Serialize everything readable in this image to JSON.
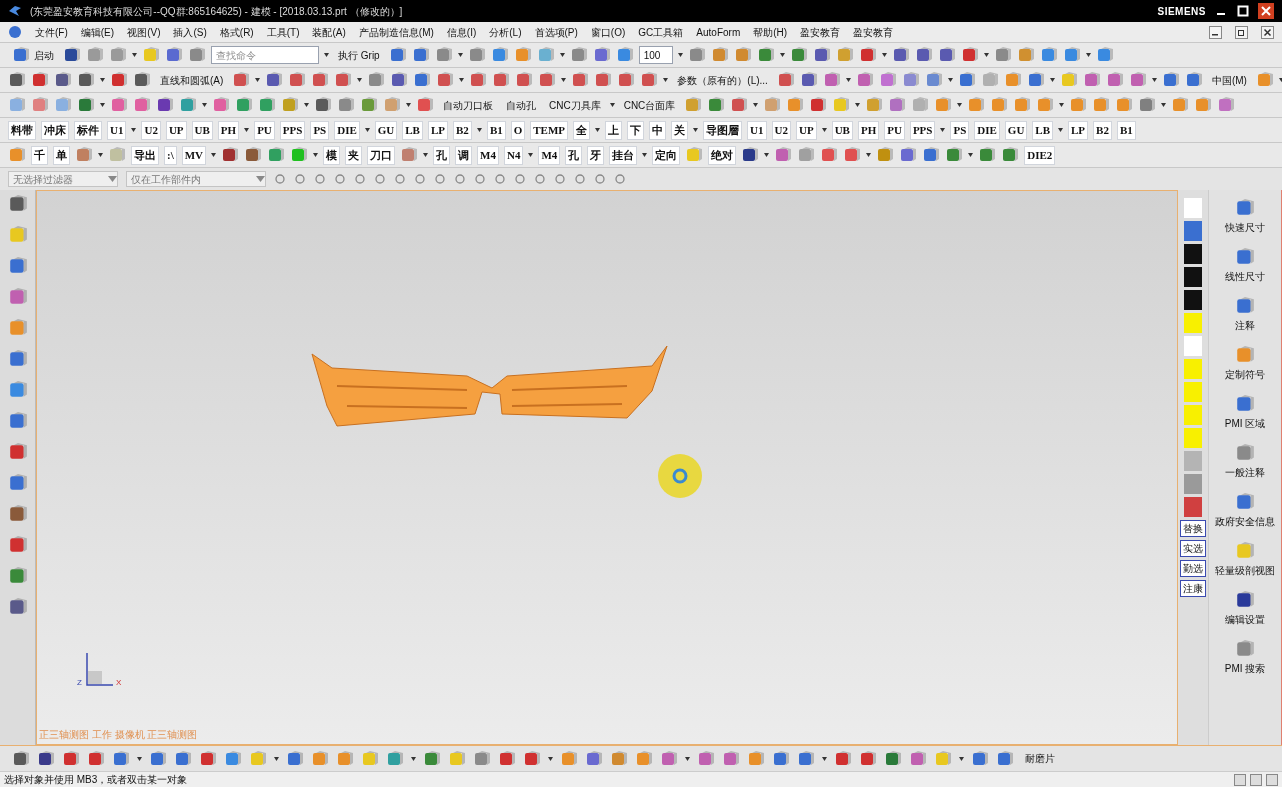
{
  "window": {
    "title": "(东莞盈安教育科技有限公司--QQ群:865164625) - 建模 - [2018.03.13.prt （修改的）]",
    "brand": "SIEMENS"
  },
  "menu": {
    "items": [
      {
        "label": "文件(F)"
      },
      {
        "label": "编辑(E)"
      },
      {
        "label": "视图(V)"
      },
      {
        "label": "插入(S)"
      },
      {
        "label": "格式(R)"
      },
      {
        "label": "工具(T)"
      },
      {
        "label": "装配(A)"
      },
      {
        "label": "产品制造信息(M)"
      },
      {
        "label": "信息(I)"
      },
      {
        "label": "分析(L)"
      },
      {
        "label": "首选项(P)"
      },
      {
        "label": "窗口(O)"
      },
      {
        "label": "GC工具箱"
      },
      {
        "label": "AutoForm"
      },
      {
        "label": "帮助(H)"
      },
      {
        "label": "盈安教育"
      },
      {
        "label": "盈安教育"
      }
    ]
  },
  "toolbars": [
    {
      "items": [
        {
          "kind": "labeled",
          "label": "启动",
          "color": "#3a6fd0"
        },
        {
          "kind": "icon",
          "color": "#2a4a9a"
        },
        {
          "kind": "icon",
          "color": "#9a9a9a"
        },
        {
          "kind": "icon",
          "color": "#9a9a9a"
        },
        {
          "kind": "icon",
          "color": "#e8c820"
        },
        {
          "kind": "icon",
          "color": "#5a6ad0"
        },
        {
          "kind": "icon",
          "color": "#8a8a8a"
        },
        {
          "kind": "search",
          "placeholder": "查找命令"
        },
        {
          "kind": "text",
          "label": "执行 Grip"
        },
        {
          "kind": "icon",
          "color": "#3a6fd0"
        },
        {
          "kind": "icon",
          "color": "#3a6fd0"
        },
        {
          "kind": "icon",
          "color": "#8a8a8a"
        },
        {
          "kind": "icon",
          "color": "#8a8a8a"
        },
        {
          "kind": "icon",
          "color": "#3a8ae0"
        },
        {
          "kind": "icon",
          "color": "#e8902a"
        },
        {
          "kind": "icon",
          "color": "#6ab0d0"
        },
        {
          "kind": "icon",
          "color": "#8a8a8a"
        },
        {
          "kind": "icon",
          "color": "#6a6ad0"
        },
        {
          "kind": "icon",
          "color": "#3a8ae0"
        },
        {
          "kind": "zoom",
          "value": "100"
        },
        {
          "kind": "icon",
          "color": "#8a8a8a"
        },
        {
          "kind": "icon",
          "color": "#d08a30"
        },
        {
          "kind": "icon",
          "color": "#d08a30"
        },
        {
          "kind": "icon",
          "color": "#3a8a3a"
        },
        {
          "kind": "icon",
          "color": "#3a8a3a"
        },
        {
          "kind": "icon",
          "color": "#5a5ab0"
        },
        {
          "kind": "icon",
          "color": "#d0a030"
        },
        {
          "kind": "icon",
          "color": "#d03030"
        },
        {
          "kind": "icon",
          "color": "#5a5ab0"
        },
        {
          "kind": "icon",
          "color": "#5a5ab0"
        },
        {
          "kind": "icon",
          "color": "#5a5ab0"
        },
        {
          "kind": "icon",
          "color": "#d03030"
        },
        {
          "kind": "icon",
          "color": "#8a8a8a"
        },
        {
          "kind": "icon",
          "color": "#d09030"
        },
        {
          "kind": "icon",
          "color": "#3a8ae0"
        },
        {
          "kind": "icon",
          "color": "#3a8ae0"
        },
        {
          "kind": "icon",
          "color": "#3a8ae0"
        }
      ]
    },
    {
      "items": [
        {
          "kind": "icon",
          "color": "#5a5a5a"
        },
        {
          "kind": "icon",
          "color": "#d03030"
        },
        {
          "kind": "icon",
          "color": "#5a5a8a"
        },
        {
          "kind": "icon",
          "color": "#5a5a5a"
        },
        {
          "kind": "icon",
          "color": "#d03030"
        },
        {
          "kind": "icon",
          "color": "#5a5a5a"
        },
        {
          "kind": "text",
          "label": "直线和圆弧(A)"
        },
        {
          "kind": "icon",
          "color": "#d05050"
        },
        {
          "kind": "icon",
          "color": "#5a5ab0"
        },
        {
          "kind": "icon",
          "color": "#d05050"
        },
        {
          "kind": "icon",
          "color": "#d05050"
        },
        {
          "kind": "icon",
          "color": "#d05050"
        },
        {
          "kind": "icon",
          "color": "#8a8a8a"
        },
        {
          "kind": "icon",
          "color": "#5a5ab0"
        },
        {
          "kind": "icon",
          "color": "#3a6fd0"
        },
        {
          "kind": "icon",
          "color": "#d05050"
        },
        {
          "kind": "icon",
          "color": "#d05050"
        },
        {
          "kind": "icon",
          "color": "#d05050"
        },
        {
          "kind": "icon",
          "color": "#d05050"
        },
        {
          "kind": "icon",
          "color": "#d05050"
        },
        {
          "kind": "icon",
          "color": "#d05050"
        },
        {
          "kind": "icon",
          "color": "#d05050"
        },
        {
          "kind": "icon",
          "color": "#d05050"
        },
        {
          "kind": "icon",
          "color": "#d05050"
        },
        {
          "kind": "text",
          "label": "参数（原有的）(L)..."
        },
        {
          "kind": "icon",
          "color": "#d05050"
        },
        {
          "kind": "icon",
          "color": "#5a5ab0"
        },
        {
          "kind": "icon",
          "color": "#c060b0"
        },
        {
          "kind": "icon",
          "color": "#c060b0"
        },
        {
          "kind": "icon",
          "color": "#c070d0"
        },
        {
          "kind": "icon",
          "color": "#8a8ad0"
        },
        {
          "kind": "icon",
          "color": "#6a8ad0"
        },
        {
          "kind": "icon",
          "color": "#3a6fd0"
        },
        {
          "kind": "icon",
          "color": "#b0b0b0"
        },
        {
          "kind": "icon",
          "color": "#e8902a"
        },
        {
          "kind": "icon",
          "color": "#3a6fd0"
        },
        {
          "kind": "icon",
          "color": "#e8c820"
        },
        {
          "kind": "icon",
          "color": "#c060b0"
        },
        {
          "kind": "icon",
          "color": "#c060b0"
        },
        {
          "kind": "icon",
          "color": "#c060b0"
        },
        {
          "kind": "icon",
          "color": "#3a6fd0"
        },
        {
          "kind": "icon",
          "color": "#3a6fd0"
        },
        {
          "kind": "text",
          "label": "中国(M)"
        },
        {
          "kind": "icon",
          "color": "#e8902a"
        }
      ]
    },
    {
      "items": [
        {
          "kind": "icon",
          "color": "#8ab0e0"
        },
        {
          "kind": "icon",
          "color": "#e08080"
        },
        {
          "kind": "icon",
          "color": "#8ab0e0"
        },
        {
          "kind": "icon",
          "color": "#2a7a3a"
        },
        {
          "kind": "icon",
          "color": "#e060a0"
        },
        {
          "kind": "icon",
          "color": "#e060a0"
        },
        {
          "kind": "icon",
          "color": "#6a3ab0"
        },
        {
          "kind": "icon",
          "color": "#30a0a0"
        },
        {
          "kind": "icon",
          "color": "#e060a0"
        },
        {
          "kind": "icon",
          "color": "#30a060"
        },
        {
          "kind": "icon",
          "color": "#30a060"
        },
        {
          "kind": "icon",
          "color": "#c0a020"
        },
        {
          "kind": "icon",
          "color": "#5a5a5a"
        },
        {
          "kind": "icon",
          "color": "#8a8a8a"
        },
        {
          "kind": "icon",
          "color": "#6a9a3a"
        },
        {
          "kind": "icon",
          "color": "#d0a070"
        },
        {
          "kind": "icon",
          "color": "#e05050"
        },
        {
          "kind": "text",
          "label": "自动刀口板"
        },
        {
          "kind": "text",
          "label": "自动孔"
        },
        {
          "kind": "text",
          "label": "CNC刀具库"
        },
        {
          "kind": "text",
          "label": "CNC台面库"
        },
        {
          "kind": "icon",
          "color": "#d0a030"
        },
        {
          "kind": "icon",
          "color": "#3a8a3a"
        },
        {
          "kind": "icon",
          "color": "#d05050"
        },
        {
          "kind": "icon",
          "color": "#d0a070"
        },
        {
          "kind": "icon",
          "color": "#e8902a"
        },
        {
          "kind": "icon",
          "color": "#d03030"
        },
        {
          "kind": "icon",
          "color": "#e8c820"
        },
        {
          "kind": "icon",
          "color": "#d0a030"
        },
        {
          "kind": "icon",
          "color": "#b070c0"
        },
        {
          "kind": "icon",
          "color": "#b0b0b0"
        },
        {
          "kind": "icon",
          "color": "#e8902a"
        },
        {
          "kind": "icon",
          "color": "#e8902a"
        },
        {
          "kind": "icon",
          "color": "#e8902a"
        },
        {
          "kind": "icon",
          "color": "#e8902a"
        },
        {
          "kind": "icon",
          "color": "#e8902a"
        },
        {
          "kind": "icon",
          "color": "#e8902a"
        },
        {
          "kind": "icon",
          "color": "#e8902a"
        },
        {
          "kind": "icon",
          "color": "#e8902a"
        },
        {
          "kind": "icon",
          "color": "#808080"
        },
        {
          "kind": "icon",
          "color": "#e8902a"
        },
        {
          "kind": "icon",
          "color": "#e8902a"
        },
        {
          "kind": "icon",
          "color": "#c070c0"
        }
      ]
    },
    {
      "items": [
        {
          "kind": "tile",
          "label": "料带"
        },
        {
          "kind": "tile",
          "label": "冲床"
        },
        {
          "kind": "tile",
          "label": "标件"
        },
        {
          "kind": "tile",
          "label": "U1"
        },
        {
          "kind": "tile",
          "label": "U2"
        },
        {
          "kind": "tile",
          "label": "UP"
        },
        {
          "kind": "tile",
          "label": "UB"
        },
        {
          "kind": "tile",
          "label": "PH"
        },
        {
          "kind": "tile",
          "label": "PU"
        },
        {
          "kind": "tile",
          "label": "PPS"
        },
        {
          "kind": "tile",
          "label": "PS"
        },
        {
          "kind": "tile",
          "label": "DIE"
        },
        {
          "kind": "tile",
          "label": "GU"
        },
        {
          "kind": "tile",
          "label": "LB"
        },
        {
          "kind": "tile",
          "label": "LP"
        },
        {
          "kind": "tile",
          "label": "B2"
        },
        {
          "kind": "tile",
          "label": "B1"
        },
        {
          "kind": "tile",
          "label": "O"
        },
        {
          "kind": "tile",
          "label": "TEMP"
        },
        {
          "kind": "tile",
          "label": "全"
        },
        {
          "kind": "tile",
          "label": "上"
        },
        {
          "kind": "tile",
          "label": "下"
        },
        {
          "kind": "tile",
          "label": "中"
        },
        {
          "kind": "tile",
          "label": "关"
        },
        {
          "kind": "tile",
          "label": "导图層"
        },
        {
          "kind": "tile",
          "label": "U1"
        },
        {
          "kind": "tile",
          "label": "U2"
        },
        {
          "kind": "tile",
          "label": "UP"
        },
        {
          "kind": "tile",
          "label": "UB"
        },
        {
          "kind": "tile",
          "label": "PH"
        },
        {
          "kind": "tile",
          "label": "PU"
        },
        {
          "kind": "tile",
          "label": "PPS"
        },
        {
          "kind": "tile",
          "label": "PS"
        },
        {
          "kind": "tile",
          "label": "DIE"
        },
        {
          "kind": "tile",
          "label": "GU"
        },
        {
          "kind": "tile",
          "label": "LB"
        },
        {
          "kind": "tile",
          "label": "LP"
        },
        {
          "kind": "tile",
          "label": "B2"
        },
        {
          "kind": "tile",
          "label": "B1"
        }
      ]
    },
    {
      "items": [
        {
          "kind": "icon",
          "color": "#e8902a"
        },
        {
          "kind": "tile",
          "label": "千"
        },
        {
          "kind": "tile",
          "label": "单"
        },
        {
          "kind": "icon",
          "color": "#c08060"
        },
        {
          "kind": "icon",
          "color": "#c0c0a0"
        },
        {
          "kind": "tile",
          "label": "导出"
        },
        {
          "kind": "tile",
          "label": ":\\"
        },
        {
          "kind": "tile",
          "label": "MV"
        },
        {
          "kind": "icon",
          "color": "#a03030"
        },
        {
          "kind": "icon",
          "color": "#8a5a3a"
        },
        {
          "kind": "icon",
          "color": "#30a060"
        },
        {
          "kind": "icon",
          "color": "#20c020"
        },
        {
          "kind": "tile",
          "label": "模"
        },
        {
          "kind": "tile",
          "label": "夹"
        },
        {
          "kind": "tile",
          "label": "刀口"
        },
        {
          "kind": "icon",
          "color": "#c08070"
        },
        {
          "kind": "tile",
          "label": "孔"
        },
        {
          "kind": "tile",
          "label": "调"
        },
        {
          "kind": "tile",
          "label": "M4"
        },
        {
          "kind": "tile",
          "label": "N4"
        },
        {
          "kind": "tile",
          "label": "M4"
        },
        {
          "kind": "tile",
          "label": "孔"
        },
        {
          "kind": "tile",
          "label": "牙"
        },
        {
          "kind": "tile",
          "label": "挂台"
        },
        {
          "kind": "tile",
          "label": "定向"
        },
        {
          "kind": "icon",
          "color": "#e8c820"
        },
        {
          "kind": "tile",
          "label": "绝对"
        },
        {
          "kind": "icon",
          "color": "#2a3a8a"
        },
        {
          "kind": "icon",
          "color": "#c060b0"
        },
        {
          "kind": "icon",
          "color": "#a0a0a0"
        },
        {
          "kind": "icon",
          "color": "#e05050"
        },
        {
          "kind": "icon",
          "color": "#e05050"
        },
        {
          "kind": "icon",
          "color": "#c09010"
        },
        {
          "kind": "icon",
          "color": "#6a6ad0"
        },
        {
          "kind": "icon",
          "color": "#3a6fd0"
        },
        {
          "kind": "icon",
          "color": "#3a8a3a"
        },
        {
          "kind": "icon",
          "color": "#3a8a3a"
        },
        {
          "kind": "icon",
          "color": "#3a8a3a"
        },
        {
          "kind": "tile",
          "label": "DIE2"
        }
      ]
    }
  ],
  "filters": [
    {
      "value": "无选择过滤器"
    },
    {
      "value": "仅在工作部件内"
    }
  ],
  "left_toolbar": [
    {
      "color": "#5a5a5a"
    },
    {
      "color": "#e8c820"
    },
    {
      "color": "#3a6fd0"
    },
    {
      "color": "#c060b0"
    },
    {
      "color": "#e8902a"
    },
    {
      "color": "#3a6fd0"
    },
    {
      "color": "#3a8ae0"
    },
    {
      "color": "#3a6fd0"
    },
    {
      "color": "#d03030"
    },
    {
      "color": "#3a6fd0"
    },
    {
      "color": "#8a5a3a"
    },
    {
      "color": "#d03030"
    },
    {
      "color": "#3a8a3a"
    },
    {
      "color": "#5a5a8a"
    }
  ],
  "side_column": [
    {
      "kind": "icon",
      "color": "#ffffff"
    },
    {
      "kind": "icon",
      "color": "#3a6fd0"
    },
    {
      "kind": "icon",
      "color": "#111111"
    },
    {
      "kind": "icon",
      "color": "#111111"
    },
    {
      "kind": "icon",
      "color": "#111111"
    },
    {
      "kind": "icon",
      "color": "#f8f000"
    },
    {
      "kind": "icon",
      "color": "#ffffff"
    },
    {
      "kind": "icon",
      "color": "#f8f000"
    },
    {
      "kind": "icon",
      "color": "#f8f000"
    },
    {
      "kind": "icon",
      "color": "#f8f000"
    },
    {
      "kind": "icon",
      "color": "#f8f000"
    },
    {
      "kind": "icon",
      "color": "#b4b4b4"
    },
    {
      "kind": "icon",
      "color": "#9a9a9a"
    },
    {
      "kind": "icon",
      "color": "#d04040"
    },
    {
      "kind": "text",
      "label": "替换"
    },
    {
      "kind": "text",
      "label": "实选"
    },
    {
      "kind": "text",
      "label": "勤选"
    },
    {
      "kind": "text",
      "label": "注康"
    }
  ],
  "resource_panel": [
    {
      "label": "快速尺寸",
      "color": "#3a6fd0"
    },
    {
      "label": "线性尺寸",
      "color": "#3a6fd0"
    },
    {
      "label": "注释",
      "color": "#3a6fd0"
    },
    {
      "label": "定制符号",
      "color": "#e8902a"
    },
    {
      "label": "PMI 区域",
      "color": "#3a6fd0"
    },
    {
      "label": "一般注释",
      "color": "#8a8a8a"
    },
    {
      "label": "政府安全信息",
      "color": "#3a6fd0"
    },
    {
      "label": "轻量级剖视图",
      "color": "#e8c820"
    },
    {
      "label": "编辑设置",
      "color": "#2a3a9a"
    },
    {
      "label": "PMI 搜索",
      "color": "#8a8a8a"
    }
  ],
  "viewport": {
    "view_label": "正三轴测图 工作 摄像机 正三轴测图",
    "axis_labels": [
      "Z",
      "X"
    ]
  },
  "bottom_toolbar": [
    {
      "kind": "icon",
      "color": "#5a5a5a"
    },
    {
      "kind": "icon",
      "color": "#3a3a8a"
    },
    {
      "kind": "icon",
      "color": "#d03030"
    },
    {
      "kind": "icon",
      "color": "#d03030"
    },
    {
      "kind": "icon",
      "color": "#3a6fd0"
    },
    {
      "kind": "icon",
      "color": "#3a6fd0"
    },
    {
      "kind": "icon",
      "color": "#3a6fd0"
    },
    {
      "kind": "icon",
      "color": "#d03030"
    },
    {
      "kind": "icon",
      "color": "#3a8ae0"
    },
    {
      "kind": "icon",
      "color": "#e8c820"
    },
    {
      "kind": "icon",
      "color": "#3a6fd0"
    },
    {
      "kind": "icon",
      "color": "#e8902a"
    },
    {
      "kind": "icon",
      "color": "#e8902a"
    },
    {
      "kind": "icon",
      "color": "#e8c820"
    },
    {
      "kind": "icon",
      "color": "#30a0a0"
    },
    {
      "kind": "icon",
      "color": "#3a8a3a"
    },
    {
      "kind": "icon",
      "color": "#e8c820"
    },
    {
      "kind": "icon",
      "color": "#8a8a8a"
    },
    {
      "kind": "icon",
      "color": "#d03030"
    },
    {
      "kind": "icon",
      "color": "#d03030"
    },
    {
      "kind": "icon",
      "color": "#e8902a"
    },
    {
      "kind": "icon",
      "color": "#6a6ad0"
    },
    {
      "kind": "icon",
      "color": "#d08a30"
    },
    {
      "kind": "icon",
      "color": "#e8902a"
    },
    {
      "kind": "icon",
      "color": "#c060b0"
    },
    {
      "kind": "icon",
      "color": "#c060b0"
    },
    {
      "kind": "icon",
      "color": "#c060b0"
    },
    {
      "kind": "icon",
      "color": "#e8902a"
    },
    {
      "kind": "icon",
      "color": "#3a6fd0"
    },
    {
      "kind": "icon",
      "color": "#3a6fd0"
    },
    {
      "kind": "icon",
      "color": "#d03030"
    },
    {
      "kind": "icon",
      "color": "#d03030"
    },
    {
      "kind": "icon",
      "color": "#2a7a3a"
    },
    {
      "kind": "icon",
      "color": "#c060b0"
    },
    {
      "kind": "icon",
      "color": "#e8c820"
    },
    {
      "kind": "icon",
      "color": "#3a6fd0"
    },
    {
      "kind": "icon",
      "color": "#3a6fd0"
    },
    {
      "kind": "text",
      "label": "耐磨片"
    }
  ],
  "status_bar": {
    "message": "选择对象并使用 MB3，或者双击某一对象"
  }
}
